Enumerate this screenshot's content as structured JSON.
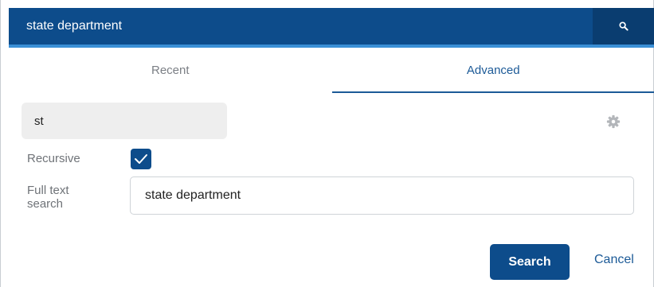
{
  "search_bar": {
    "query": "state department",
    "button_icon": "search-icon"
  },
  "tabs": [
    {
      "label": "Recent",
      "active": false
    },
    {
      "label": "Advanced",
      "active": true
    }
  ],
  "advanced": {
    "location_chip": "st",
    "settings_icon": "gear-icon",
    "recursive_label": "Recursive",
    "recursive_checked": true,
    "fulltext_label": "Full text search",
    "fulltext_value": "state department"
  },
  "actions": {
    "search_label": "Search",
    "cancel_label": "Cancel"
  },
  "colors": {
    "primary": "#0d4c8b",
    "accent_line": "#3a8fd6",
    "tab_active": "#1c5a97"
  }
}
